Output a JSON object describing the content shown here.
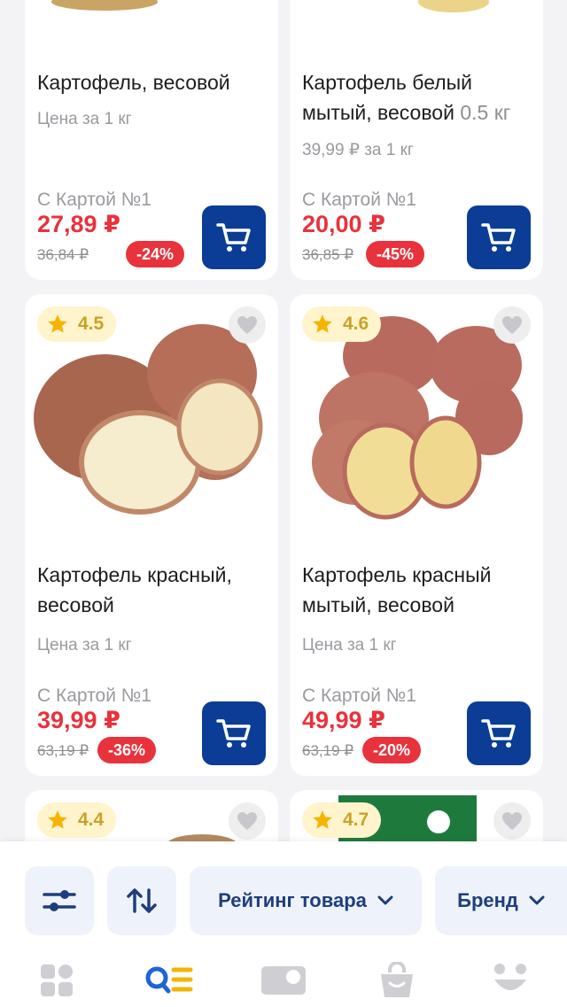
{
  "cards": [
    {
      "title": "Картофель, весовой",
      "unit": "Цена за 1 кг",
      "card_label": "С Картой №1",
      "price": "27,89 ₽",
      "old_price": "36,84 ₽",
      "discount": "-24%"
    },
    {
      "title": "Картофель белый мытый, весовой",
      "weight": "0.5 кг",
      "unit": "39,99 ₽ за 1 кг",
      "card_label": "С Картой №1",
      "price": "20,00 ₽",
      "old_price": "36,85 ₽",
      "discount": "-45%"
    },
    {
      "rating": "4.5",
      "title": "Картофель красный, весовой",
      "unit": "Цена за 1 кг",
      "card_label": "С Картой №1",
      "price": "39,99 ₽",
      "old_price": "63,19 ₽",
      "discount": "-36%"
    },
    {
      "rating": "4.6",
      "title": "Картофель красный мытый, весовой",
      "unit": "Цена за 1 кг",
      "card_label": "С Картой №1",
      "price": "49,99 ₽",
      "old_price": "63,19 ₽",
      "discount": "-20%"
    },
    {
      "rating": "4.4"
    },
    {
      "rating": "4.7"
    }
  ],
  "filters": {
    "rating_label": "Рейтинг товара",
    "brand_label": "Бренд"
  },
  "icons": {
    "filter": "sliders-icon",
    "sort": "sort-arrows-icon",
    "cart": "cart-icon",
    "star": "star-icon",
    "heart": "heart-icon"
  },
  "colors": {
    "price": "#e8323c",
    "cart_button": "#0b3d96",
    "rating_bg": "#fff4cc",
    "star": "#f5b400",
    "tab_active_blue": "#1f63d6",
    "tab_active_yellow": "#f5b400"
  }
}
